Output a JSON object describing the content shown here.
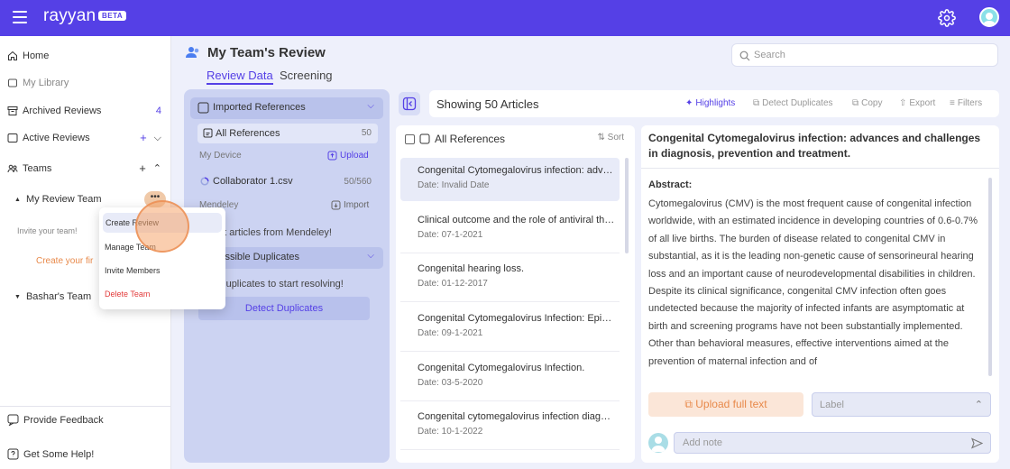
{
  "app": {
    "logo": "rayyan",
    "badge": "BETA"
  },
  "sidebar": {
    "home": "Home",
    "library": "My Library",
    "archived": "Archived Reviews",
    "archived_count": "4",
    "active": "Active Reviews",
    "teams": "Teams",
    "team1": "My Review Team",
    "invite": "Invite your team!",
    "create_first": "Create your fir",
    "team2": "Bashar's Team",
    "feedback": "Provide Feedback",
    "help": "Get Some Help!"
  },
  "context_menu": {
    "dots": "•••",
    "items": [
      "Create Review",
      "Manage Team",
      "Invite Members",
      "Delete Team"
    ]
  },
  "header": {
    "title": "My Team's Review",
    "tabs": [
      "Review Data",
      "Screening"
    ],
    "search_placeholder": "Search"
  },
  "sources": {
    "imported": "Imported References",
    "all_refs": "All References",
    "all_refs_count": "50",
    "my_device": "My Device",
    "upload": "Upload",
    "file_name": "Collaborator 1.csv",
    "file_count": "50/560",
    "mendeley": "Mendeley",
    "import": "Import",
    "mendeley_text": "Import articles from Mendeley!",
    "duplicates": "Possible Duplicates",
    "dup_text": "Find duplicates to start resolving!",
    "detect": "Detect Duplicates"
  },
  "toolbar": {
    "showing": "Showing 50 Articles",
    "highlights": "Highlights",
    "detect": "Detect Duplicates",
    "copy": "Copy",
    "export": "Export",
    "filters": "Filters"
  },
  "list": {
    "header": "All References",
    "sort": "Sort",
    "articles": [
      {
        "title": "Congenital Cytomegalovirus infection: advances and challenges",
        "date": "Date: Invalid Date"
      },
      {
        "title": "Clinical outcome and the role of antiviral therapy",
        "date": "Date: 07-1-2021"
      },
      {
        "title": "Congenital hearing loss.",
        "date": "Date: 01-12-2017"
      },
      {
        "title": "Congenital Cytomegalovirus Infection: Epidemiology",
        "date": "Date: 09-1-2021"
      },
      {
        "title": "Congenital Cytomegalovirus Infection.",
        "date": "Date: 03-5-2020"
      },
      {
        "title": "Congenital cytomegalovirus infection diagnosis",
        "date": "Date: 10-1-2022"
      }
    ]
  },
  "detail": {
    "title": "Congenital Cytomegalovirus infection: advances and challenges in diagnosis, prevention and treatment.",
    "abstract_label": "Abstract:",
    "abstract": "Cytomegalovirus (CMV) is the most frequent cause of congenital infection worldwide, with an estimated incidence in developing countries of 0.6-0.7% of all live births. The burden of disease related to congenital CMV in substantial, as it is the leading non-genetic cause of sensorineural hearing loss and an important cause of neurodevelopmental disabilities in children. Despite its clinical significance, congenital CMV infection often goes undetected because the majority of infected infants are asymptomatic at birth and screening programs have not been substantially implemented. Other than behavioral measures, effective interventions aimed at the prevention of maternal infection and of",
    "upload_full_text": "Upload full text",
    "label_placeholder": "Label",
    "note_placeholder": "Add note"
  }
}
